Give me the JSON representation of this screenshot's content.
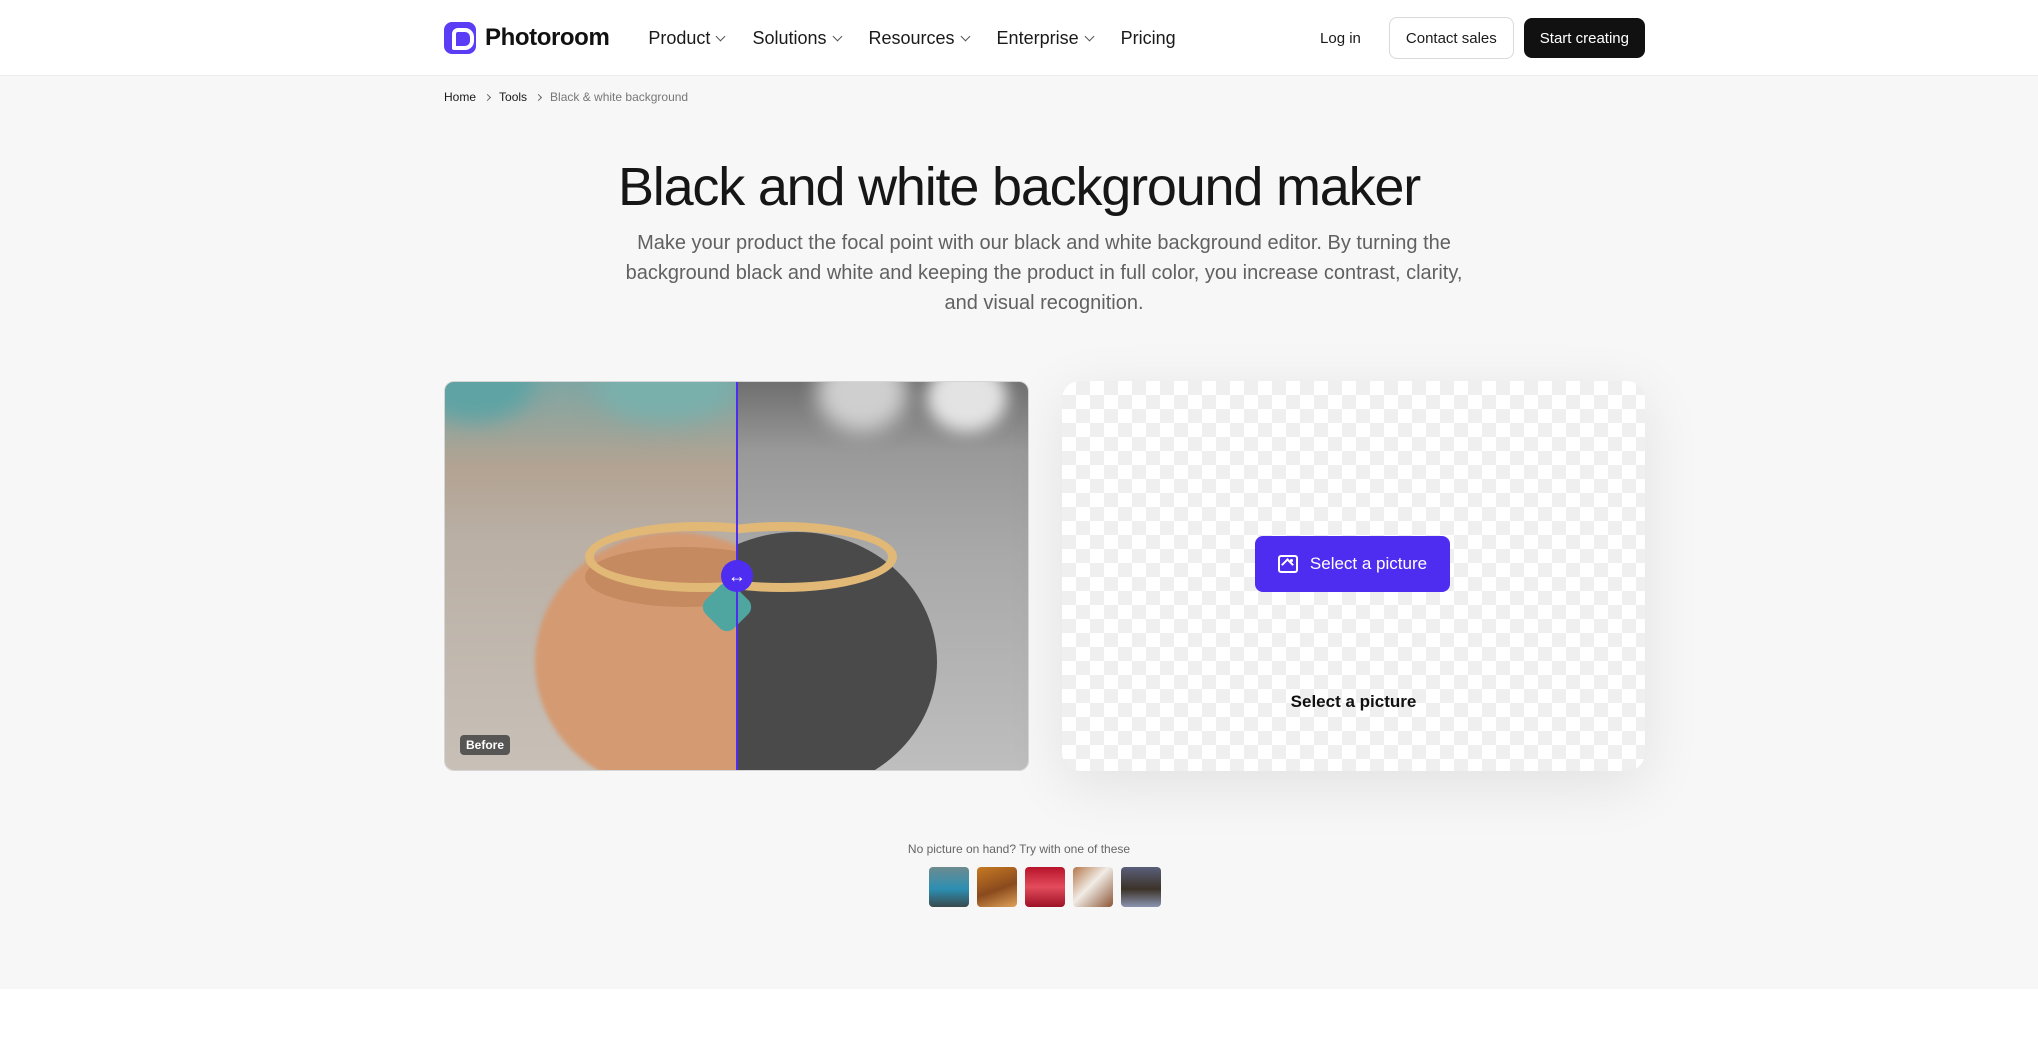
{
  "nav": {
    "brand": "Photoroom",
    "menu": [
      {
        "label": "Product",
        "has_dropdown": true
      },
      {
        "label": "Solutions",
        "has_dropdown": true
      },
      {
        "label": "Resources",
        "has_dropdown": true
      },
      {
        "label": "Enterprise",
        "has_dropdown": true
      },
      {
        "label": "Pricing",
        "has_dropdown": false
      }
    ],
    "login": "Log in",
    "contact": "Contact sales",
    "cta": "Start creating"
  },
  "breadcrumb": [
    "Home",
    "Tools",
    "Black & white background"
  ],
  "hero": {
    "title": "Black and white background maker",
    "subtitle": "Make your product the focal point with our black and white background editor. By turning the background black and white and keeping the product in full color, you increase contrast, clarity, and visual recognition."
  },
  "compare": {
    "before_label": "Before",
    "handle_icon": "horizontal-arrows-icon",
    "split_fraction": 0.5
  },
  "upload": {
    "button_label": "Select a picture",
    "link_label": "Select a picture",
    "button_icon": "image-icon"
  },
  "samples": {
    "label": "No picture on hand? Try with one of these",
    "items": [
      "car",
      "shoes",
      "woman-in-red",
      "notebook",
      "man-portrait"
    ]
  },
  "colors": {
    "brand": "#5b3df5",
    "accent": "#4f2df0",
    "dark_button": "#111111",
    "section_bg": "#f7f7f7"
  }
}
